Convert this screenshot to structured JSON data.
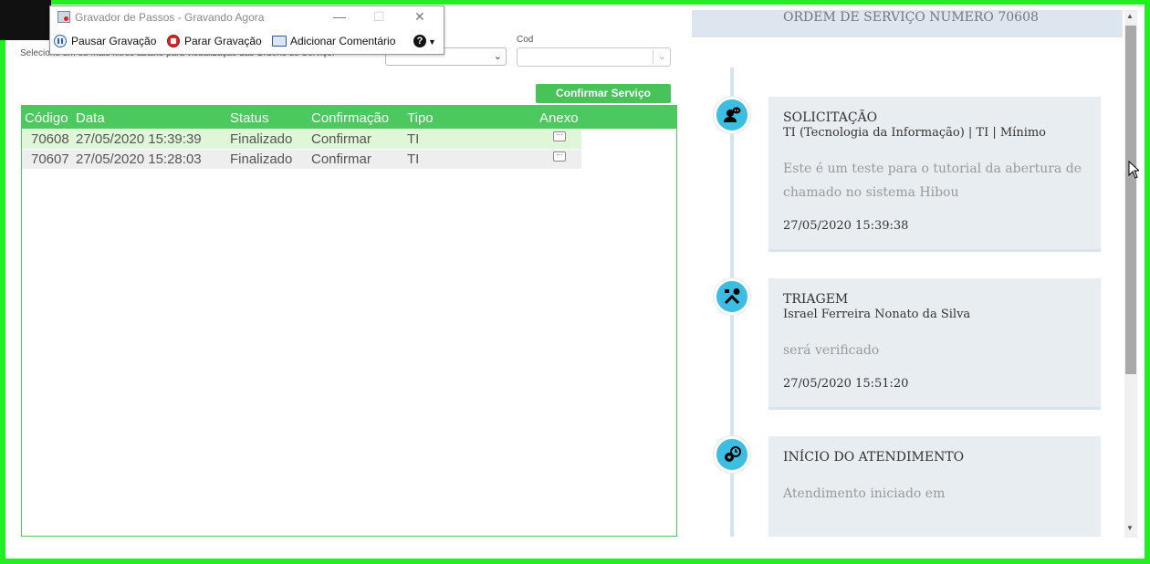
{
  "recorder": {
    "title": "Gravador de Passos - Gravando Agora",
    "pause_label": "Pausar Gravação",
    "stop_label": "Parar Gravação",
    "comment_label": "Adicionar Comentário",
    "help_glyph": "?",
    "minimize_glyph": "—",
    "maximize_glyph": "☐",
    "close_glyph": "✕"
  },
  "filters": {
    "hint": "Selecione um ou mais filtros abaixo para visualização das Ordens de Serviço.",
    "cod_label": "Cod",
    "chevron": "⌄"
  },
  "actions": {
    "confirm_service": "Confirmar Serviço"
  },
  "grid": {
    "columns": [
      "Código",
      "Data",
      "Status",
      "Confirmação",
      "Tipo",
      "Anexo"
    ],
    "rows": [
      {
        "codigo": "70608",
        "data": "27/05/2020 15:39:39",
        "status": "Finalizado",
        "confirmacao": "Confirmar",
        "tipo": "TI"
      },
      {
        "codigo": "70607",
        "data": "27/05/2020 15:28:03",
        "status": "Finalizado",
        "confirmacao": "Confirmar",
        "tipo": "TI"
      }
    ]
  },
  "order": {
    "title": "ORDEM DE SERVIÇO NUMERO 70608",
    "events": [
      {
        "title": "SOLICITAÇÃO",
        "subtitle": "TI (Tecnologia da Informação)  |  TI  |  Mínimo",
        "description": "Este é um teste para o tutorial da abertura de chamado no sistema Hibou",
        "timestamp": "27/05/2020 15:39:38",
        "icon": "user-chat-icon"
      },
      {
        "title": "TRIAGEM",
        "subtitle": "Israel Ferreira Nonato da Silva",
        "description": "será verificado",
        "timestamp": "27/05/2020 15:51:20",
        "icon": "tools-icon"
      },
      {
        "title": "INÍCIO DO ATENDIMENTO",
        "subtitle": "",
        "description": "Atendimento iniciado em",
        "timestamp": "",
        "icon": "gear-clock-icon"
      }
    ]
  },
  "colors": {
    "accent_green": "#4cc95e",
    "frame_green": "#22ee22",
    "timeline_blue": "#3dbde2",
    "card_bg": "#e8edf1"
  }
}
